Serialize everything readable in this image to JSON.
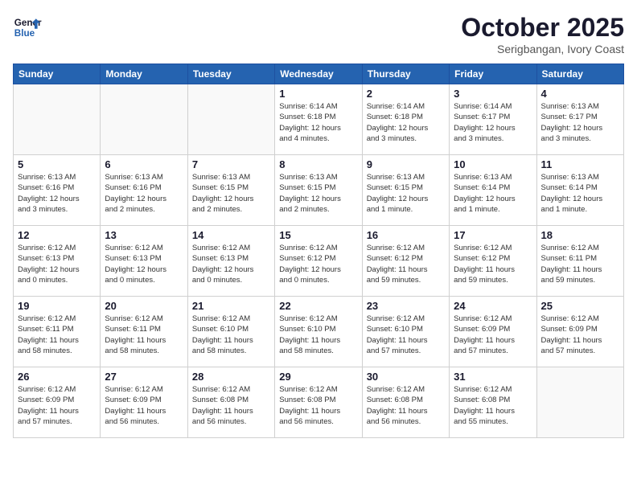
{
  "header": {
    "logo_line1": "General",
    "logo_line2": "Blue",
    "month": "October 2025",
    "location": "Serigbangan, Ivory Coast"
  },
  "weekdays": [
    "Sunday",
    "Monday",
    "Tuesday",
    "Wednesday",
    "Thursday",
    "Friday",
    "Saturday"
  ],
  "weeks": [
    [
      {
        "day": "",
        "detail": ""
      },
      {
        "day": "",
        "detail": ""
      },
      {
        "day": "",
        "detail": ""
      },
      {
        "day": "1",
        "detail": "Sunrise: 6:14 AM\nSunset: 6:18 PM\nDaylight: 12 hours\nand 4 minutes."
      },
      {
        "day": "2",
        "detail": "Sunrise: 6:14 AM\nSunset: 6:18 PM\nDaylight: 12 hours\nand 3 minutes."
      },
      {
        "day": "3",
        "detail": "Sunrise: 6:14 AM\nSunset: 6:17 PM\nDaylight: 12 hours\nand 3 minutes."
      },
      {
        "day": "4",
        "detail": "Sunrise: 6:13 AM\nSunset: 6:17 PM\nDaylight: 12 hours\nand 3 minutes."
      }
    ],
    [
      {
        "day": "5",
        "detail": "Sunrise: 6:13 AM\nSunset: 6:16 PM\nDaylight: 12 hours\nand 3 minutes."
      },
      {
        "day": "6",
        "detail": "Sunrise: 6:13 AM\nSunset: 6:16 PM\nDaylight: 12 hours\nand 2 minutes."
      },
      {
        "day": "7",
        "detail": "Sunrise: 6:13 AM\nSunset: 6:15 PM\nDaylight: 12 hours\nand 2 minutes."
      },
      {
        "day": "8",
        "detail": "Sunrise: 6:13 AM\nSunset: 6:15 PM\nDaylight: 12 hours\nand 2 minutes."
      },
      {
        "day": "9",
        "detail": "Sunrise: 6:13 AM\nSunset: 6:15 PM\nDaylight: 12 hours\nand 1 minute."
      },
      {
        "day": "10",
        "detail": "Sunrise: 6:13 AM\nSunset: 6:14 PM\nDaylight: 12 hours\nand 1 minute."
      },
      {
        "day": "11",
        "detail": "Sunrise: 6:13 AM\nSunset: 6:14 PM\nDaylight: 12 hours\nand 1 minute."
      }
    ],
    [
      {
        "day": "12",
        "detail": "Sunrise: 6:12 AM\nSunset: 6:13 PM\nDaylight: 12 hours\nand 0 minutes."
      },
      {
        "day": "13",
        "detail": "Sunrise: 6:12 AM\nSunset: 6:13 PM\nDaylight: 12 hours\nand 0 minutes."
      },
      {
        "day": "14",
        "detail": "Sunrise: 6:12 AM\nSunset: 6:13 PM\nDaylight: 12 hours\nand 0 minutes."
      },
      {
        "day": "15",
        "detail": "Sunrise: 6:12 AM\nSunset: 6:12 PM\nDaylight: 12 hours\nand 0 minutes."
      },
      {
        "day": "16",
        "detail": "Sunrise: 6:12 AM\nSunset: 6:12 PM\nDaylight: 11 hours\nand 59 minutes."
      },
      {
        "day": "17",
        "detail": "Sunrise: 6:12 AM\nSunset: 6:12 PM\nDaylight: 11 hours\nand 59 minutes."
      },
      {
        "day": "18",
        "detail": "Sunrise: 6:12 AM\nSunset: 6:11 PM\nDaylight: 11 hours\nand 59 minutes."
      }
    ],
    [
      {
        "day": "19",
        "detail": "Sunrise: 6:12 AM\nSunset: 6:11 PM\nDaylight: 11 hours\nand 58 minutes."
      },
      {
        "day": "20",
        "detail": "Sunrise: 6:12 AM\nSunset: 6:11 PM\nDaylight: 11 hours\nand 58 minutes."
      },
      {
        "day": "21",
        "detail": "Sunrise: 6:12 AM\nSunset: 6:10 PM\nDaylight: 11 hours\nand 58 minutes."
      },
      {
        "day": "22",
        "detail": "Sunrise: 6:12 AM\nSunset: 6:10 PM\nDaylight: 11 hours\nand 58 minutes."
      },
      {
        "day": "23",
        "detail": "Sunrise: 6:12 AM\nSunset: 6:10 PM\nDaylight: 11 hours\nand 57 minutes."
      },
      {
        "day": "24",
        "detail": "Sunrise: 6:12 AM\nSunset: 6:09 PM\nDaylight: 11 hours\nand 57 minutes."
      },
      {
        "day": "25",
        "detail": "Sunrise: 6:12 AM\nSunset: 6:09 PM\nDaylight: 11 hours\nand 57 minutes."
      }
    ],
    [
      {
        "day": "26",
        "detail": "Sunrise: 6:12 AM\nSunset: 6:09 PM\nDaylight: 11 hours\nand 57 minutes."
      },
      {
        "day": "27",
        "detail": "Sunrise: 6:12 AM\nSunset: 6:09 PM\nDaylight: 11 hours\nand 56 minutes."
      },
      {
        "day": "28",
        "detail": "Sunrise: 6:12 AM\nSunset: 6:08 PM\nDaylight: 11 hours\nand 56 minutes."
      },
      {
        "day": "29",
        "detail": "Sunrise: 6:12 AM\nSunset: 6:08 PM\nDaylight: 11 hours\nand 56 minutes."
      },
      {
        "day": "30",
        "detail": "Sunrise: 6:12 AM\nSunset: 6:08 PM\nDaylight: 11 hours\nand 56 minutes."
      },
      {
        "day": "31",
        "detail": "Sunrise: 6:12 AM\nSunset: 6:08 PM\nDaylight: 11 hours\nand 55 minutes."
      },
      {
        "day": "",
        "detail": ""
      }
    ]
  ]
}
